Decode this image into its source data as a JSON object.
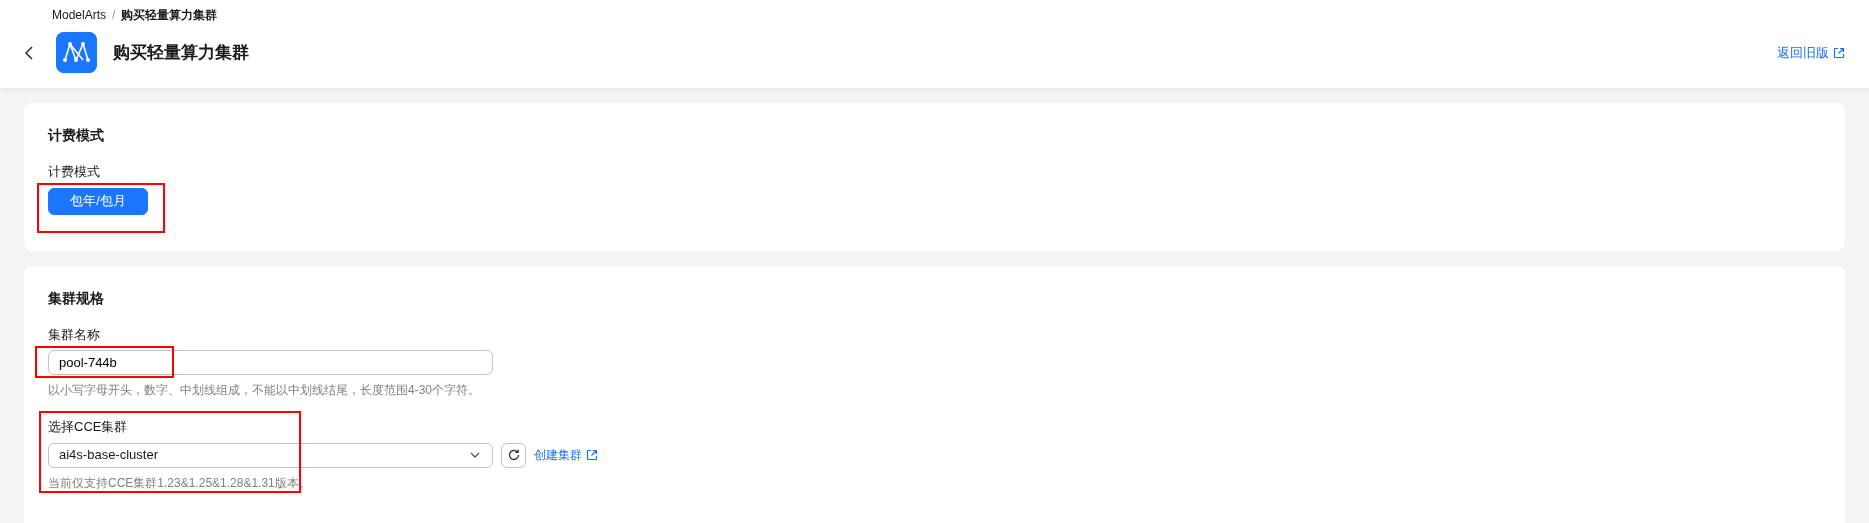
{
  "breadcrumb_separator": "/",
  "breadcrumb": [
    {
      "label": "ModelArts",
      "current": false
    },
    {
      "label": "购买轻量算力集群",
      "current": true
    }
  ],
  "header": {
    "title": "购买轻量算力集群",
    "old_version_link": "返回旧版"
  },
  "sections": [
    {
      "title": "计费模式",
      "fields": [
        {
          "kind": "options",
          "label": "计费模式",
          "highlighted": true,
          "options": [
            {
              "label": "包年/包月",
              "selected": true
            }
          ]
        }
      ]
    },
    {
      "title": "集群规格",
      "fields": [
        {
          "kind": "text",
          "label": "集群名称",
          "highlighted": true,
          "value": "pool-744b",
          "hint": "以小写字母开头，数字、中划线组成，不能以中划线结尾，长度范围4-30个字符。"
        },
        {
          "kind": "select",
          "label": "选择CCE集群",
          "highlighted": true,
          "value": "ai4s-base-cluster",
          "link": "创建集群",
          "hint": "当前仅支持CCE集群1.23&1.25&1.28&1.31版本。"
        }
      ]
    }
  ]
}
